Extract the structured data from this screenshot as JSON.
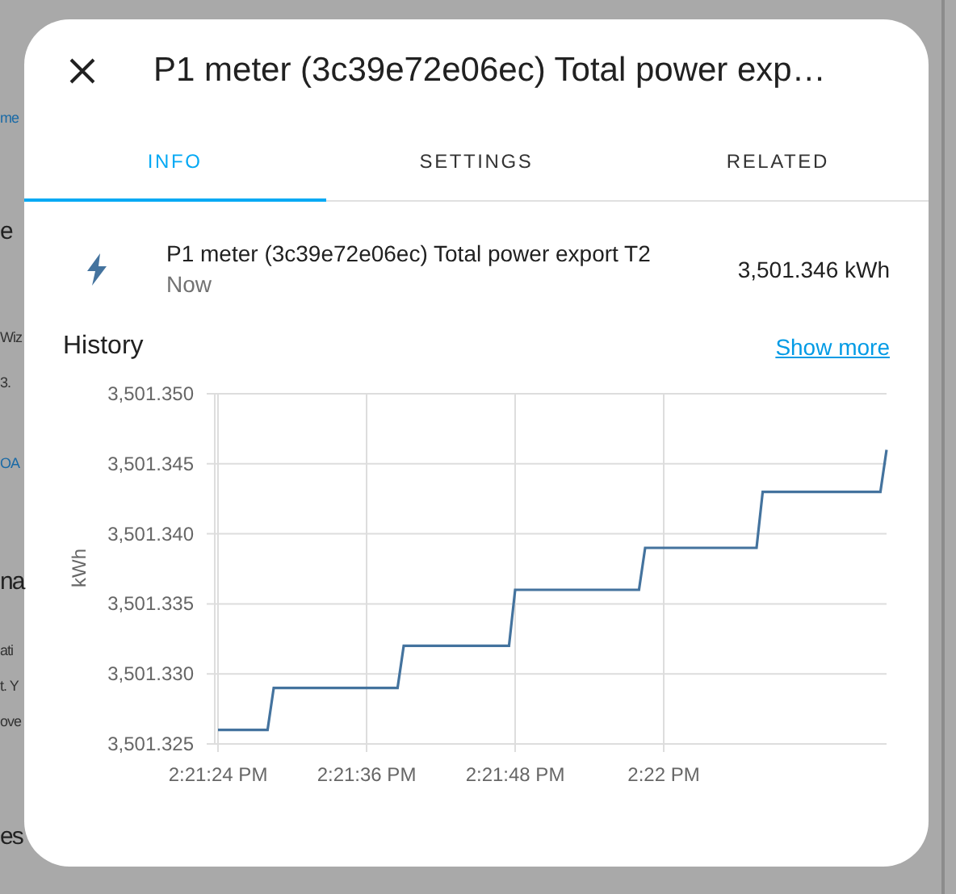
{
  "background": {
    "fragments": [
      {
        "text": "me",
        "kind": "link"
      },
      {
        "text": "e",
        "kind": "heading"
      },
      {
        "text": "Wiz",
        "kind": "text"
      },
      {
        "text": "3.",
        "kind": "text"
      },
      {
        "text": "OA",
        "kind": "link"
      },
      {
        "text": "na",
        "kind": "heading"
      },
      {
        "text": "ati",
        "kind": "text"
      },
      {
        "text": "t. Y",
        "kind": "text"
      },
      {
        "text": "ove",
        "kind": "text"
      },
      {
        "text": "es",
        "kind": "heading"
      }
    ]
  },
  "dialog": {
    "title": "P1 meter (3c39e72e06ec) Total power exp…",
    "tabs": [
      {
        "label": "INFO",
        "selected": true
      },
      {
        "label": "SETTINGS",
        "selected": false
      },
      {
        "label": "RELATED",
        "selected": false
      }
    ],
    "entity": {
      "name": "P1 meter (3c39e72e06ec) Total power export T2",
      "time": "Now",
      "state": "3,501.346 kWh"
    },
    "history": {
      "title": "History",
      "link": "Show more",
      "chart_data": {
        "type": "line",
        "ylabel": "kWh",
        "grid": true,
        "categories": [
          "2:21:24 PM",
          null,
          null,
          null,
          null,
          null,
          null,
          null,
          null,
          null,
          null,
          null,
          null,
          null,
          null,
          null,
          null,
          null,
          null,
          null,
          null,
          null,
          null,
          null,
          "2:21:36 PM",
          null,
          null,
          null,
          null,
          null,
          null,
          null,
          null,
          null,
          null,
          null,
          null,
          null,
          null,
          null,
          null,
          null,
          null,
          null,
          null,
          null,
          null,
          null,
          "2:21:48 PM",
          null,
          null,
          null,
          null,
          null,
          null,
          null,
          null,
          null,
          null,
          null,
          null,
          null,
          null,
          null,
          null,
          null,
          null,
          null,
          null,
          null,
          null,
          null,
          "2:22 PM",
          null,
          null,
          null,
          null,
          null,
          null,
          null,
          null,
          null,
          null,
          null,
          null,
          null,
          null,
          null,
          null,
          null,
          null,
          null,
          null,
          null,
          null,
          null,
          null,
          null,
          null,
          null,
          null,
          null,
          null,
          null,
          null,
          null,
          null,
          null,
          null
        ],
        "series": [
          {
            "color": "#44739e",
            "values": [
              3501.326,
              3501.326,
              3501.326,
              3501.326,
              3501.326,
              3501.326,
              3501.326,
              3501.326,
              3501.326,
              3501.329,
              3501.329,
              3501.329,
              3501.329,
              3501.329,
              3501.329,
              3501.329,
              3501.329,
              3501.329,
              3501.329,
              3501.329,
              3501.329,
              3501.329,
              3501.329,
              3501.329,
              3501.329,
              3501.329,
              3501.329,
              3501.329,
              3501.329,
              3501.329,
              3501.332,
              3501.332,
              3501.332,
              3501.332,
              3501.332,
              3501.332,
              3501.332,
              3501.332,
              3501.332,
              3501.332,
              3501.332,
              3501.332,
              3501.332,
              3501.332,
              3501.332,
              3501.332,
              3501.332,
              3501.332,
              3501.336,
              3501.336,
              3501.336,
              3501.336,
              3501.336,
              3501.336,
              3501.336,
              3501.336,
              3501.336,
              3501.336,
              3501.336,
              3501.336,
              3501.336,
              3501.336,
              3501.336,
              3501.336,
              3501.336,
              3501.336,
              3501.336,
              3501.336,
              3501.336,
              3501.339,
              3501.339,
              3501.339,
              3501.339,
              3501.339,
              3501.339,
              3501.339,
              3501.339,
              3501.339,
              3501.339,
              3501.339,
              3501.339,
              3501.339,
              3501.339,
              3501.339,
              3501.339,
              3501.339,
              3501.339,
              3501.339,
              3501.343,
              3501.343,
              3501.343,
              3501.343,
              3501.343,
              3501.343,
              3501.343,
              3501.343,
              3501.343,
              3501.343,
              3501.343,
              3501.343,
              3501.343,
              3501.343,
              3501.343,
              3501.343,
              3501.343,
              3501.343,
              3501.343,
              3501.343,
              3501.346
            ]
          }
        ],
        "ylim": [
          3501.325,
          3501.35
        ],
        "yticks": [
          {
            "value": 3501.325,
            "label": "3,501.325"
          },
          {
            "value": 3501.33,
            "label": "3,501.330"
          },
          {
            "value": 3501.335,
            "label": "3,501.335"
          },
          {
            "value": 3501.34,
            "label": "3,501.340"
          },
          {
            "value": 3501.345,
            "label": "3,501.345"
          },
          {
            "value": 3501.35,
            "label": "3,501.350"
          }
        ]
      }
    }
  }
}
